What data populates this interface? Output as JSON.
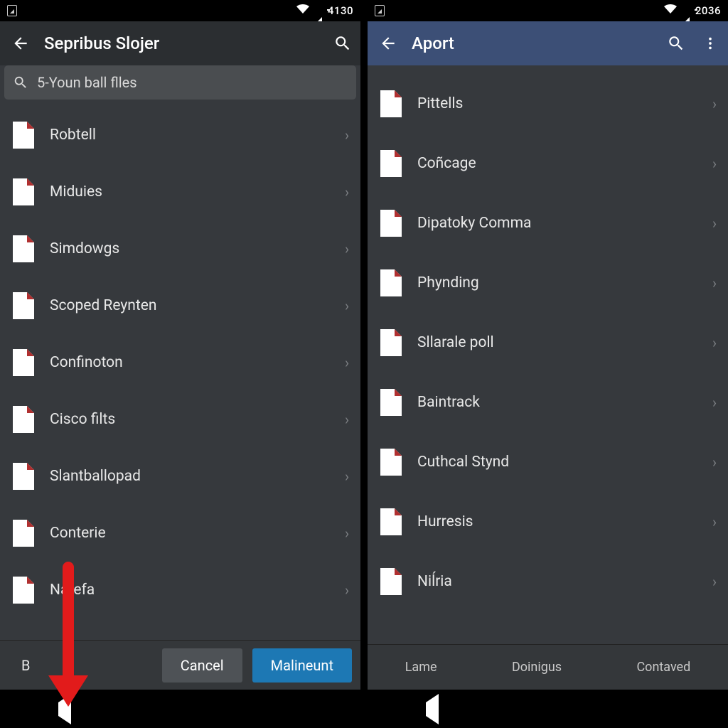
{
  "left": {
    "status_time": "4130",
    "title": "Sepribus Slojer",
    "search_placeholder": "5-Youn ball flles",
    "items": [
      "Robtell",
      "Miduies",
      "Simdowgs",
      "Scoped Reynten",
      "Confinoton",
      "Cisco filts",
      "Slantballopad",
      "Conterie",
      "Narefa"
    ],
    "bottom_extra": "B",
    "cancel": "Cancel",
    "confirm": "Malineunt"
  },
  "right": {
    "status_time": "2036",
    "title": "Aport",
    "items": [
      "Pittells",
      "Coñcage",
      "Dipatoky Comma",
      "Phynding",
      "Sllarale poll",
      "Baintrack",
      "Cuthcal Stynd",
      "Hurresis",
      "Niĺria"
    ],
    "tabs": [
      "Lame",
      "Doinigus",
      "Contaved"
    ]
  }
}
